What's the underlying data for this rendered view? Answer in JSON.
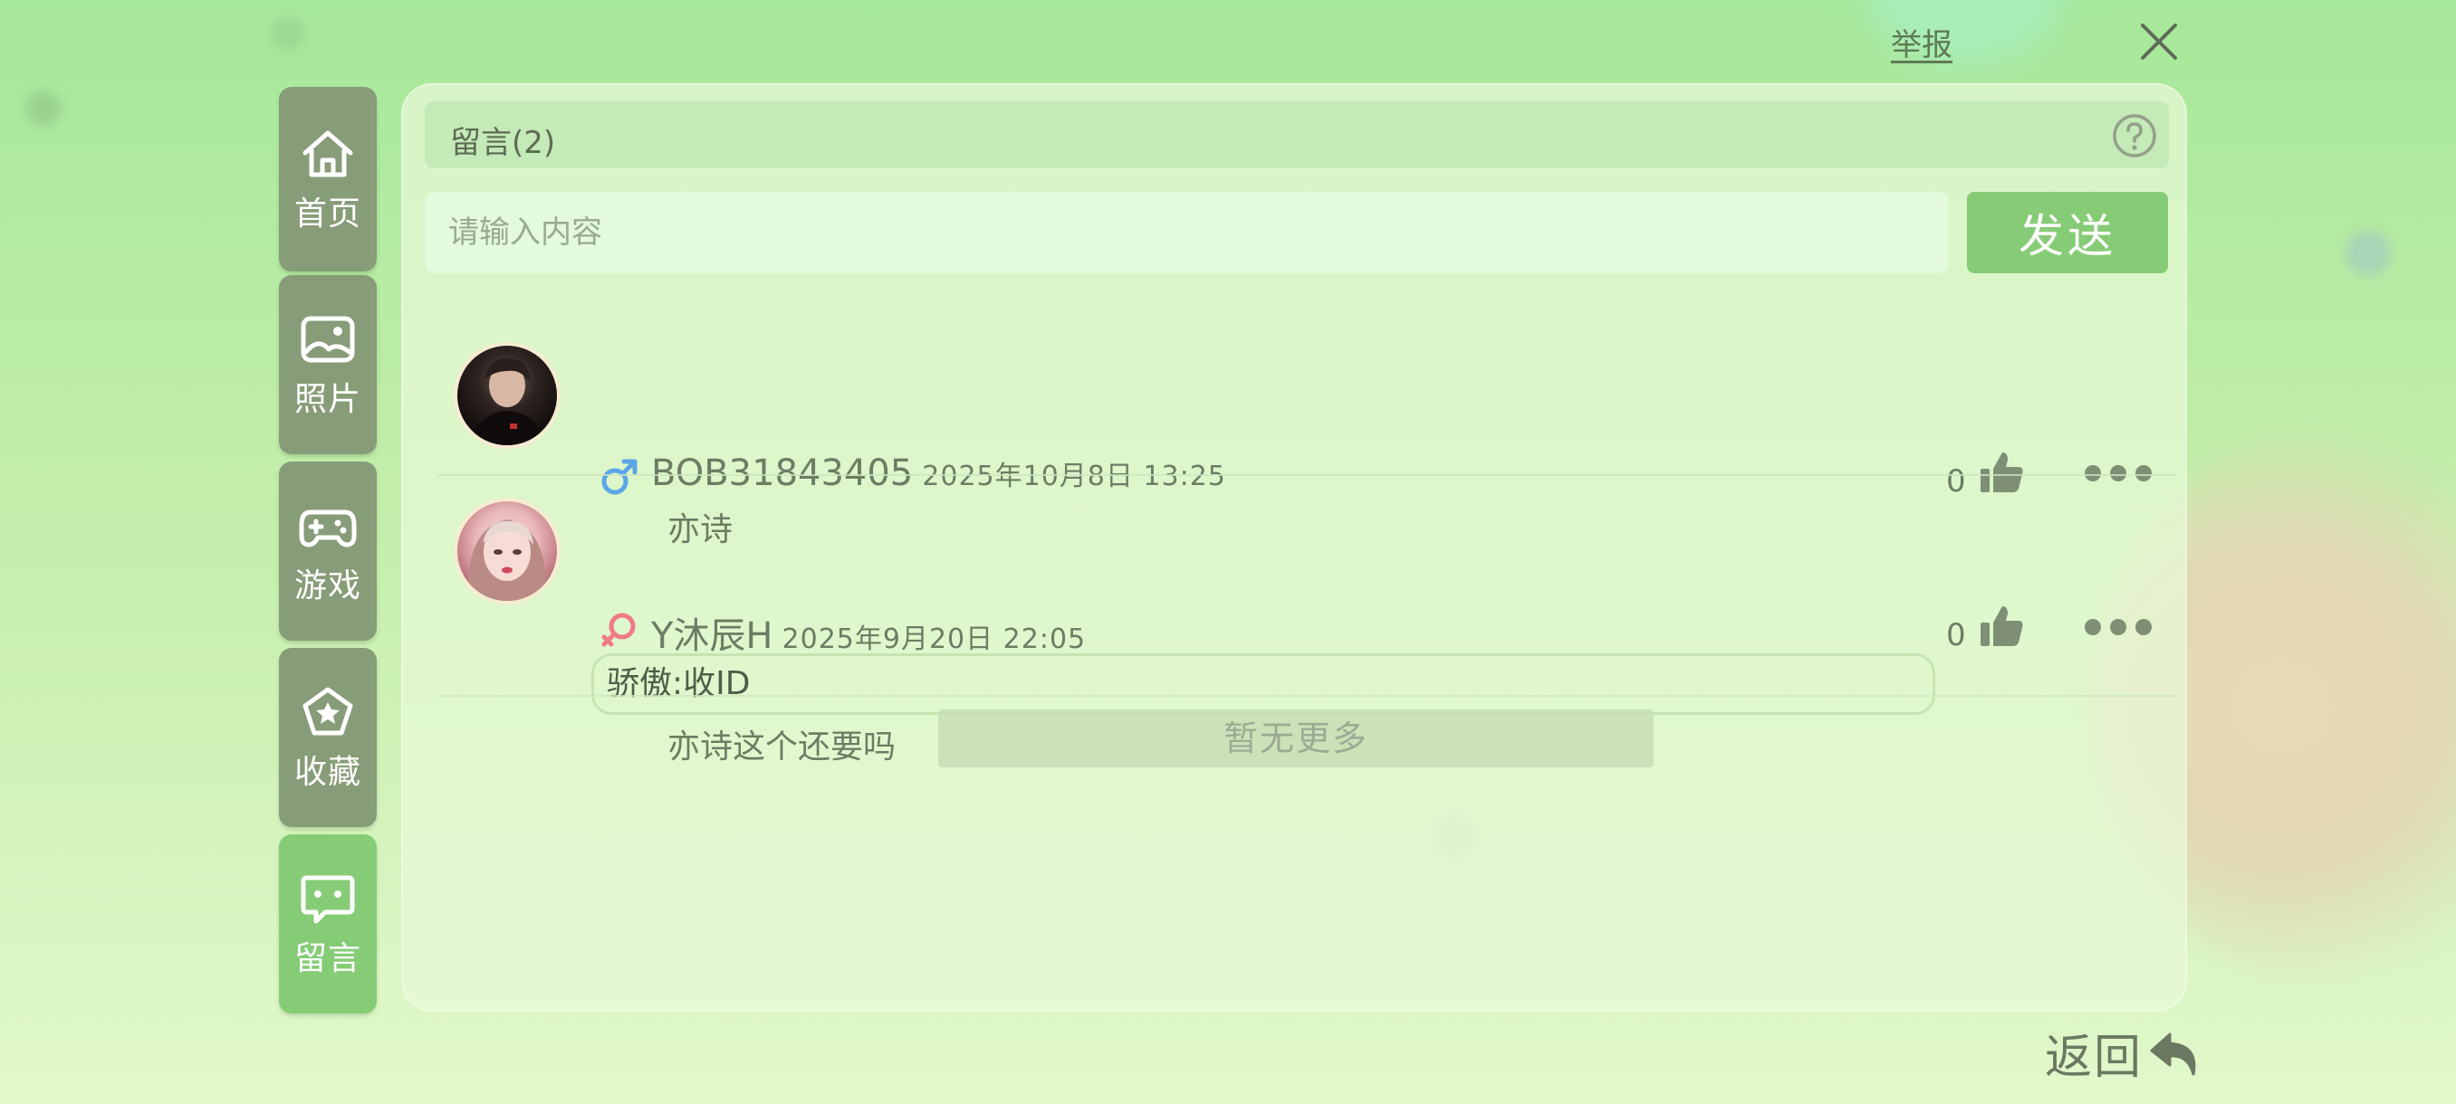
{
  "top": {
    "report_label": "举报"
  },
  "sidebar": {
    "items": [
      {
        "label": "首页",
        "icon": "home-icon"
      },
      {
        "label": "照片",
        "icon": "image-icon"
      },
      {
        "label": "游戏",
        "icon": "gamepad-icon"
      },
      {
        "label": "收藏",
        "icon": "star-icon"
      },
      {
        "label": "留言",
        "icon": "message-icon",
        "active": true
      }
    ]
  },
  "panel": {
    "title": "留言(2)",
    "input_placeholder": "请输入内容",
    "send_label": "发送",
    "no_more": "暂无更多"
  },
  "comments": [
    {
      "gender": "male",
      "username": "BOB31843405",
      "time": "2025年10月8日 13:25",
      "body": "亦诗",
      "likes": "0"
    },
    {
      "gender": "female",
      "username": "Y沐辰H",
      "time": "2025年9月20日 22:05",
      "quote": "骄傲:收ID",
      "body": "亦诗这个还要吗",
      "likes": "0"
    }
  ],
  "footer": {
    "back_label": "返回"
  },
  "colors": {
    "nav_inactive": "#879c78",
    "nav_active": "#86cc76",
    "send_button": "#86cc76",
    "male": "#5aa6e6",
    "female": "#f07a86",
    "text": "#6c7d64"
  }
}
